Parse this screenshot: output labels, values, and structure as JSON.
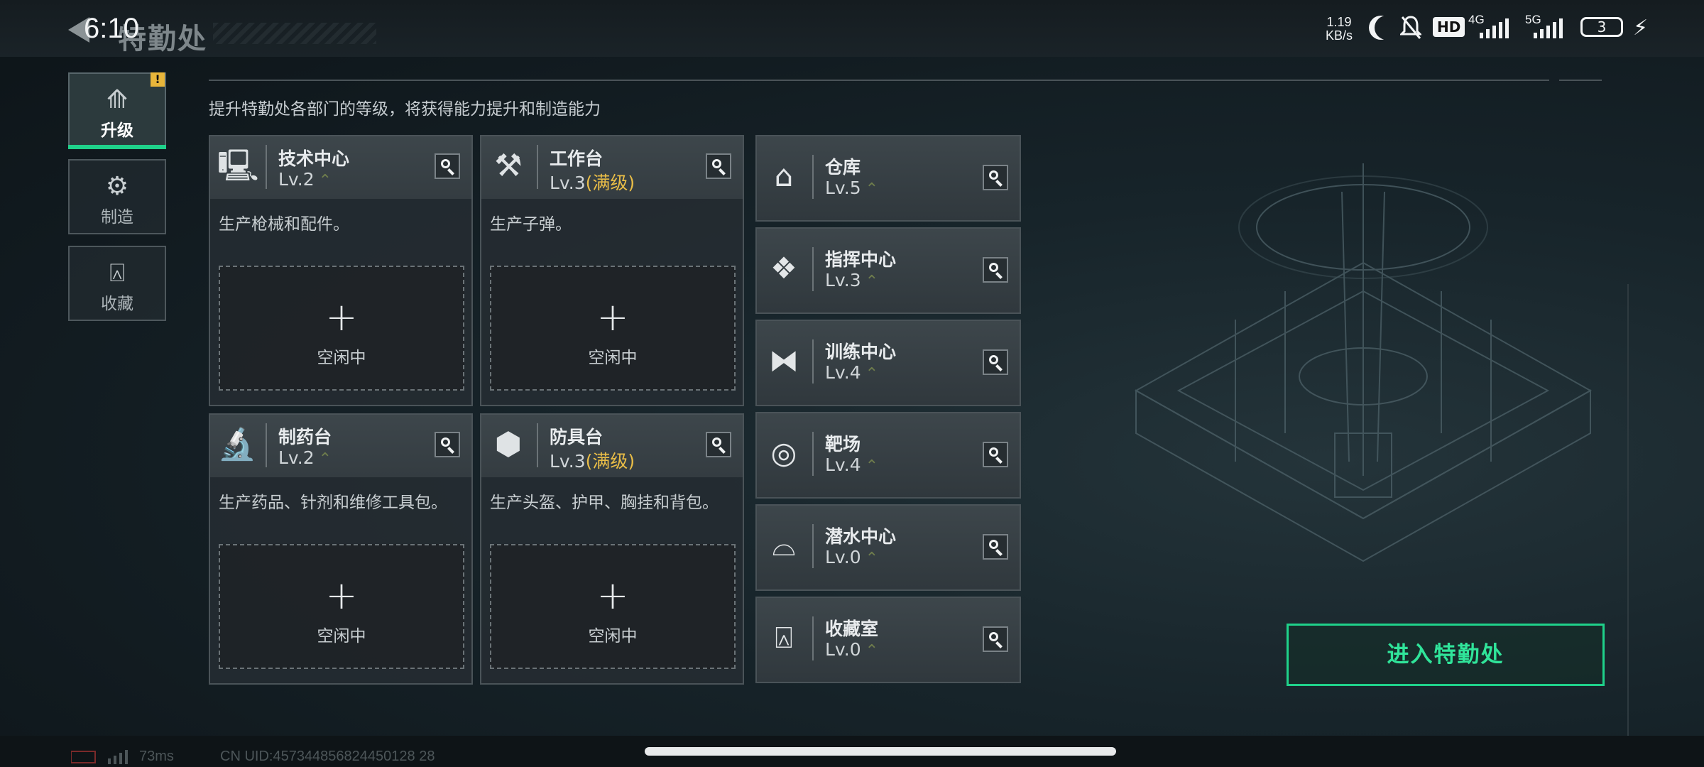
{
  "status_bar": {
    "time": "6:10",
    "net_speed_value": "1.19",
    "net_speed_unit": "KB/s",
    "hd_badge": "HD",
    "net_4g": "4G",
    "net_5g": "5G",
    "battery": "3"
  },
  "header": {
    "title": "特勤处"
  },
  "nav": {
    "items": [
      {
        "label": "升级",
        "icon": "upgrade-icon",
        "active": true
      },
      {
        "label": "制造",
        "icon": "gears-icon",
        "active": false
      },
      {
        "label": "收藏",
        "icon": "collection-icon",
        "active": false
      }
    ],
    "alert": "!"
  },
  "description": "提升特勤处各部门的等级，将获得能力提升和制造能力",
  "large_cards": [
    {
      "name": "技术中心",
      "level": "Lv.2",
      "max": "",
      "desc": "生产枪械和配件。",
      "slot_status": "空闲中",
      "icon": "computer-icon"
    },
    {
      "name": "工作台",
      "level": "Lv.3",
      "max": "(满级)",
      "desc": "生产子弹。",
      "slot_status": "空闲中",
      "icon": "tools-icon"
    },
    {
      "name": "制药台",
      "level": "Lv.2",
      "max": "",
      "desc": "生产药品、针剂和维修工具包。",
      "slot_status": "空闲中",
      "icon": "microscope-icon"
    },
    {
      "name": "防具台",
      "level": "Lv.3",
      "max": "(满级)",
      "desc": "生产头盔、护甲、胸挂和背包。",
      "slot_status": "空闲中",
      "icon": "boxes-icon"
    }
  ],
  "small_cards": [
    {
      "name": "仓库",
      "level": "Lv.5",
      "icon": "warehouse-icon"
    },
    {
      "name": "指挥中心",
      "level": "Lv.3",
      "icon": "command-icon"
    },
    {
      "name": "训练中心",
      "level": "Lv.4",
      "icon": "dumbbell-icon"
    },
    {
      "name": "靶场",
      "level": "Lv.4",
      "icon": "target-icon"
    },
    {
      "name": "潜水中心",
      "level": "Lv.0",
      "icon": "diving-mask-icon"
    },
    {
      "name": "收藏室",
      "level": "Lv.0",
      "icon": "trophy-case-icon"
    }
  ],
  "enter_button": "进入特勤处",
  "footer": {
    "ping": "73ms",
    "uid": "CN UID:457344856824450128 28"
  },
  "colors": {
    "accent": "#1fd18a",
    "max_level": "#e9bd47",
    "alert": "#e8b53a"
  }
}
